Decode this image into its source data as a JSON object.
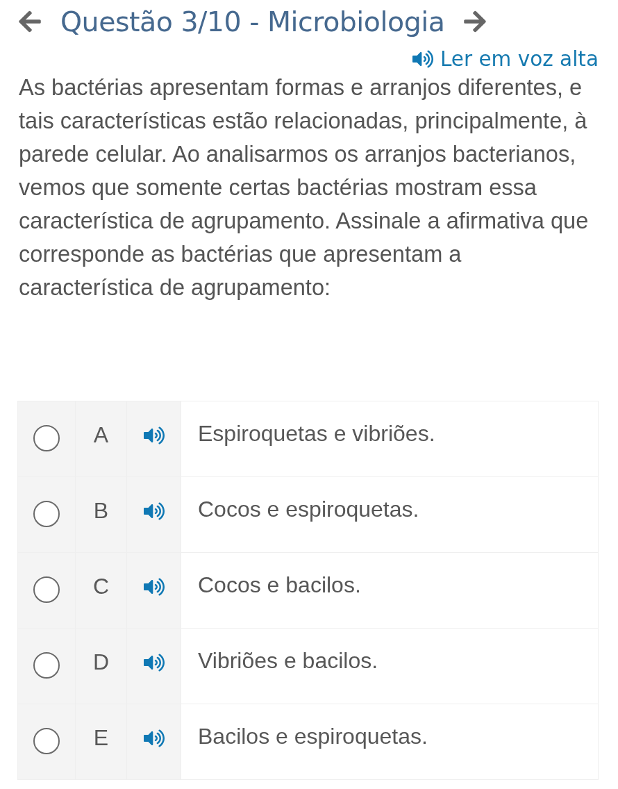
{
  "header": {
    "title": "Questão 3/10 - Microbiologia",
    "read_aloud": "Ler em voz alta"
  },
  "question": {
    "text": "As bactérias apresentam formas e arranjos diferentes, e tais características estão relacionadas, principalmente, à parede celular. Ao analisarmos os arranjos bacterianos, vemos que somente certas bactérias mostram essa característica de agrupamento. Assinale a afirmativa que corresponde as bactérias que apresentam a característica de agrupamento:"
  },
  "options": [
    {
      "letter": "A",
      "text": "Espiroquetas e vibriões.",
      "selected": false
    },
    {
      "letter": "B",
      "text": "Cocos e espiroquetas.",
      "selected": false
    },
    {
      "letter": "C",
      "text": "Cocos e bacilos.",
      "selected": false
    },
    {
      "letter": "D",
      "text": "Vibriões e bacilos.",
      "selected": false
    },
    {
      "letter": "E",
      "text": "Bacilos e espiroquetas.",
      "selected": false
    }
  ]
}
